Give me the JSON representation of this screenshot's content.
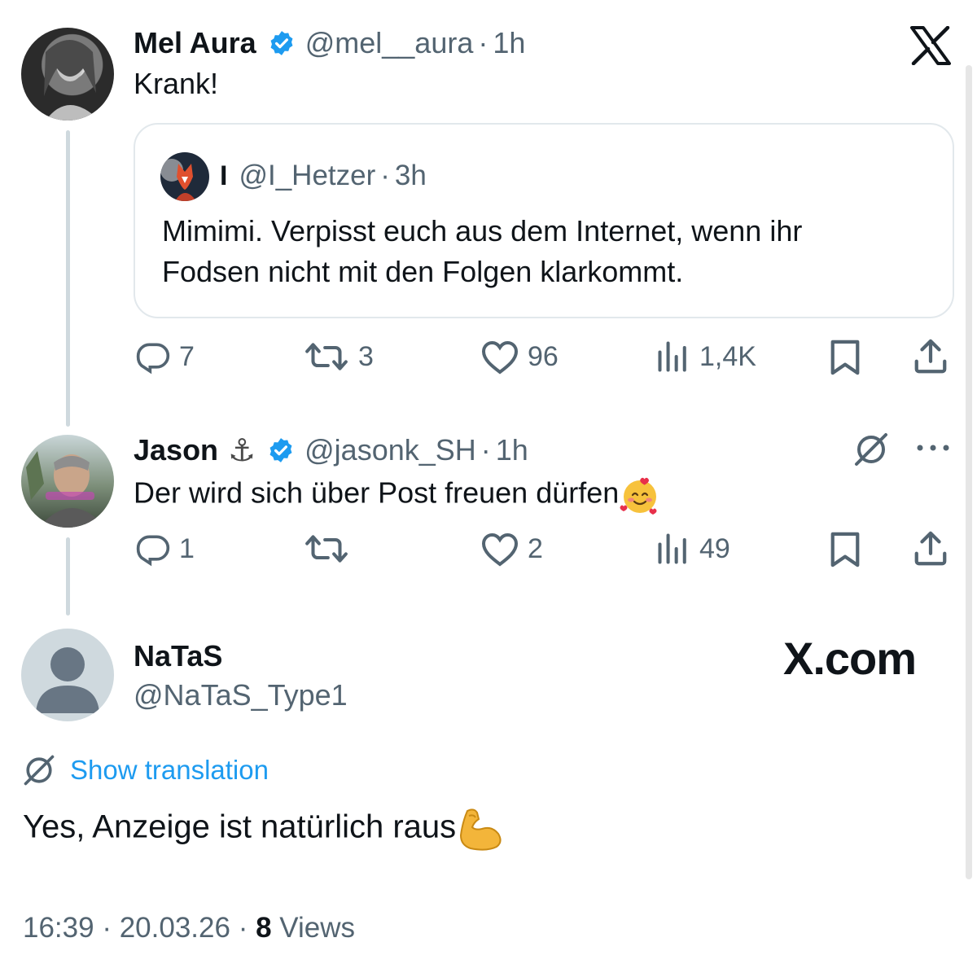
{
  "brand": {
    "corner_logo": "x-logo",
    "watermark": "X.com"
  },
  "tweets": [
    {
      "display_name": "Mel Aura",
      "verified": true,
      "handle": "@mel__aura",
      "time": "1h",
      "text": "Krank!",
      "quoted": {
        "display_name": "I",
        "handle": "@I_Hetzer",
        "time": "3h",
        "text_line1": "Mimimi. Verpisst euch aus dem Internet, wenn ihr",
        "text_line2": "Fodsen nicht mit den Folgen klarkommt."
      },
      "actions": {
        "replies": "7",
        "reposts": "3",
        "likes": "96",
        "views": "1,4K"
      }
    },
    {
      "display_name": "Jason",
      "name_emoji": "⚓",
      "verified": true,
      "handle": "@jasonk_SH",
      "time": "1h",
      "text": "Der wird sich über Post freuen dürfen",
      "text_emoji": "🥰",
      "actions": {
        "replies": "1",
        "reposts": "",
        "likes": "2",
        "views": "49"
      }
    }
  ],
  "main_tweet": {
    "display_name": "NaTaS",
    "handle": "@NaTaS_Type1",
    "show_translation": "Show translation",
    "text": "Yes, Anzeige ist natürlich raus",
    "text_emoji": "💪",
    "time": "16:39",
    "date": "20.03.26",
    "views_count": "8",
    "views_label": "Views"
  },
  "colors": {
    "accent": "#1d9bf0",
    "text": "#0f1419",
    "secondary": "#536471",
    "border": "#e2e8ec"
  },
  "icons": [
    "x-logo",
    "verified-badge-icon",
    "reply-icon",
    "repost-icon",
    "like-icon",
    "views-icon",
    "bookmark-icon",
    "share-icon",
    "translate-icon",
    "more-icon",
    "anchor-emoji",
    "smiling-hearts-emoji",
    "flexed-biceps-emoji"
  ]
}
